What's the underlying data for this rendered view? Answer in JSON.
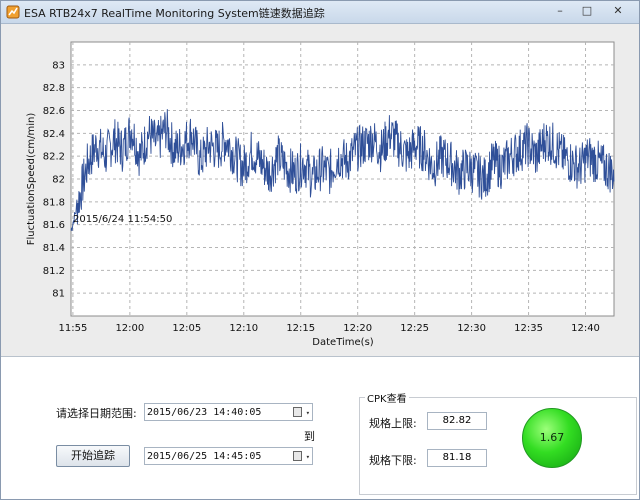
{
  "window": {
    "title": "ESA RTB24x7 RealTime Monitoring System链速数据追踪",
    "min_label": "–",
    "max_label": "□",
    "close_label": "✕"
  },
  "chart_data": {
    "type": "line",
    "xlabel": "DateTime(s)",
    "ylabel": "FluctuationSpeed(cm/min)",
    "ylim": [
      80.8,
      83.2
    ],
    "x_tick_labels": [
      "11:55",
      "12:00",
      "12:05",
      "12:10",
      "12:15",
      "12:20",
      "12:25",
      "12:30",
      "12:35",
      "12:40"
    ],
    "y_tick_labels": [
      "81",
      "81.2",
      "81.4",
      "81.6",
      "81.8",
      "82",
      "82.2",
      "82.4",
      "82.6",
      "82.8",
      "83"
    ],
    "annotation": "2015/6/24 11:54:50",
    "grid": true,
    "line_color": "#2f4f98",
    "series": [
      {
        "x_start": "11:54:50",
        "x_end": "12:42:30",
        "values": [
          81.55,
          81.85,
          82.15,
          82.3,
          82.2,
          82.35,
          82.25,
          82.45,
          82.2,
          82.4,
          82.3,
          82.45,
          82.25,
          82.3,
          82.4,
          82.15,
          82.3,
          82.25,
          82.35,
          82.2,
          82.1,
          82.25,
          82.15,
          82.05,
          82.2,
          82.1,
          82.05,
          82.15,
          82.0,
          82.1,
          82.05,
          82.2,
          82.15,
          82.25,
          82.3,
          82.35,
          82.25,
          82.4,
          82.3,
          82.2,
          82.3,
          82.25,
          82.1,
          82.2,
          82.15,
          82.05,
          82.1,
          82.05,
          82.0,
          82.15,
          82.1,
          82.2,
          82.25,
          82.3,
          82.2,
          82.35,
          82.3,
          82.2,
          82.15,
          82.1,
          82.2,
          82.15,
          82.1,
          82.05
        ]
      }
    ]
  },
  "controls": {
    "date_range_label": "请选择日期范围:",
    "date_from": "2015/06/23  14:40:05",
    "to_label": "到",
    "date_to": "2015/06/25  14:45:05",
    "start_button": "开始追踪",
    "dropdown_arrow": "▾"
  },
  "cpk": {
    "title": "CPK查看",
    "upper_label": "规格上限:",
    "upper_value": "82.82",
    "lower_label": "规格下限:",
    "lower_value": "81.18",
    "cpk_value": "1.67",
    "status_color": "#33dd22"
  }
}
